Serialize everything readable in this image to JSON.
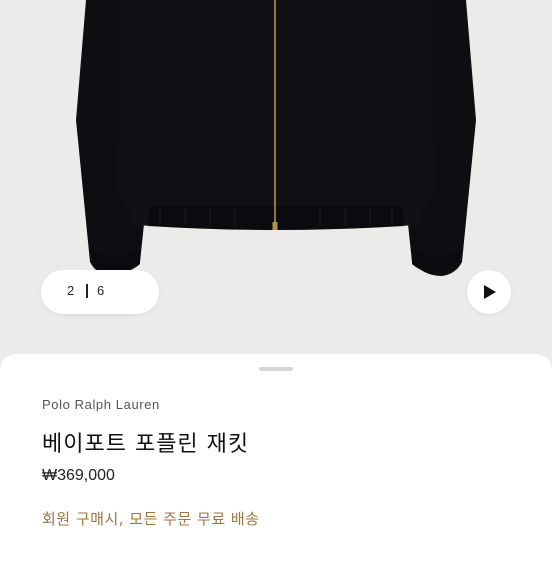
{
  "carousel": {
    "current_index": "2",
    "total_count": "6",
    "next_icon": "play-icon"
  },
  "product": {
    "brand": "Polo Ralph Lauren",
    "title": "베이포트 포플린 재킷",
    "price": "₩369,000",
    "promo": "회원 구매시, 모든 주문 무료 배송"
  },
  "colors": {
    "background": "#ecebea",
    "jacket": "#0e0f12",
    "promo_text": "#a0743f"
  }
}
